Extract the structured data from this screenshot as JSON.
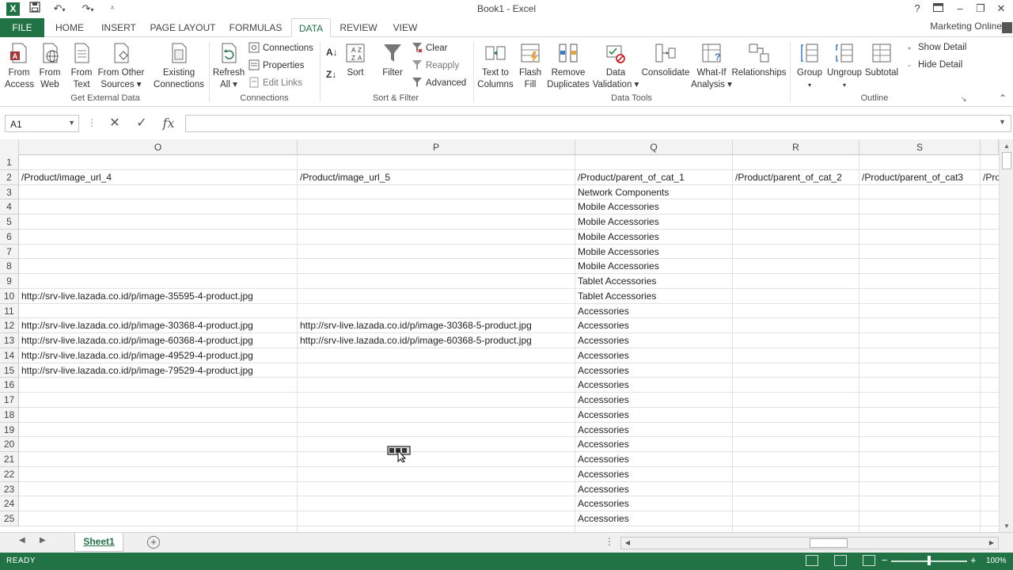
{
  "window": {
    "title": "Book1 - Excel",
    "account": "Marketing Online",
    "excel_logo": "X"
  },
  "tabs": [
    "FILE",
    "HOME",
    "INSERT",
    "PAGE LAYOUT",
    "FORMULAS",
    "DATA",
    "REVIEW",
    "VIEW"
  ],
  "active_tab": "DATA",
  "ribbon": {
    "get_external_data": {
      "label": "Get External Data",
      "from_access": [
        "From",
        "Access"
      ],
      "from_web": [
        "From",
        "Web"
      ],
      "from_text": [
        "From",
        "Text"
      ],
      "from_other": [
        "From Other",
        "Sources ▾"
      ]
    },
    "existing": [
      "Existing",
      "Connections"
    ],
    "connections": {
      "label": "Connections",
      "refresh": [
        "Refresh",
        "All ▾"
      ],
      "connections": "Connections",
      "properties": "Properties",
      "edit_links": "Edit Links"
    },
    "sort_filter": {
      "label": "Sort & Filter",
      "sort": "Sort",
      "filter": "Filter",
      "clear": "Clear",
      "reapply": "Reapply",
      "advanced": "Advanced"
    },
    "data_tools": {
      "label": "Data Tools",
      "text_to_columns": [
        "Text to",
        "Columns"
      ],
      "flash_fill": [
        "Flash",
        "Fill"
      ],
      "remove_duplicates": [
        "Remove",
        "Duplicates"
      ],
      "data_validation": [
        "Data",
        "Validation ▾"
      ],
      "consolidate": "Consolidate",
      "what_if": [
        "What-If",
        "Analysis ▾"
      ],
      "relationships": "Relationships"
    },
    "outline": {
      "label": "Outline",
      "group": "Group",
      "ungroup": "Ungroup",
      "subtotal": "Subtotal",
      "show_detail": "Show Detail",
      "hide_detail": "Hide Detail"
    }
  },
  "formula_bar": {
    "name_box": "A1",
    "formula": ""
  },
  "columns": [
    "O",
    "P",
    "Q",
    "R",
    "S"
  ],
  "rows": [
    "1",
    "2",
    "3",
    "4",
    "5",
    "6",
    "7",
    "8",
    "9",
    "10",
    "11",
    "12",
    "13",
    "14",
    "15",
    "16",
    "17",
    "18",
    "19",
    "20",
    "21",
    "22",
    "23",
    "24",
    "25"
  ],
  "cells": {
    "header_row": [
      "/Product/image_url_4",
      "/Product/image_url_5",
      "/Product/parent_of_cat_1",
      "/Product/parent_of_cat_2",
      "/Product/parent_of_cat3",
      "/Pro"
    ],
    "col_O": [
      "",
      "",
      "",
      "",
      "",
      "",
      "",
      "http://srv-live.lazada.co.id/p/image-35595-4-product.jpg",
      "",
      "http://srv-live.lazada.co.id/p/image-30368-4-product.jpg",
      "http://srv-live.lazada.co.id/p/image-60368-4-product.jpg",
      "http://srv-live.lazada.co.id/p/image-49529-4-product.jpg",
      "http://srv-live.lazada.co.id/p/image-79529-4-product.jpg",
      "",
      "",
      "",
      "",
      "",
      "",
      "",
      "",
      "",
      ""
    ],
    "col_P": [
      "",
      "",
      "",
      "",
      "",
      "",
      "",
      "",
      "",
      "http://srv-live.lazada.co.id/p/image-30368-5-product.jpg",
      "http://srv-live.lazada.co.id/p/image-60368-5-product.jpg",
      "",
      "",
      "",
      "",
      "",
      "",
      "",
      "",
      "",
      "",
      "",
      ""
    ],
    "col_Q": [
      "Network Components",
      "Mobile Accessories",
      "Mobile Accessories",
      "Mobile Accessories",
      "Mobile Accessories",
      "Mobile Accessories",
      "Tablet Accessories",
      "Tablet Accessories",
      "Accessories",
      "Accessories",
      "Accessories",
      "Accessories",
      "Accessories",
      "Accessories",
      "Accessories",
      "Accessories",
      "Accessories",
      "Accessories",
      "Accessories",
      "Accessories",
      "Accessories",
      "Accessories",
      "Accessories"
    ]
  },
  "sheets": [
    "Sheet1"
  ],
  "status": {
    "text": "READY",
    "zoom": "100%"
  }
}
